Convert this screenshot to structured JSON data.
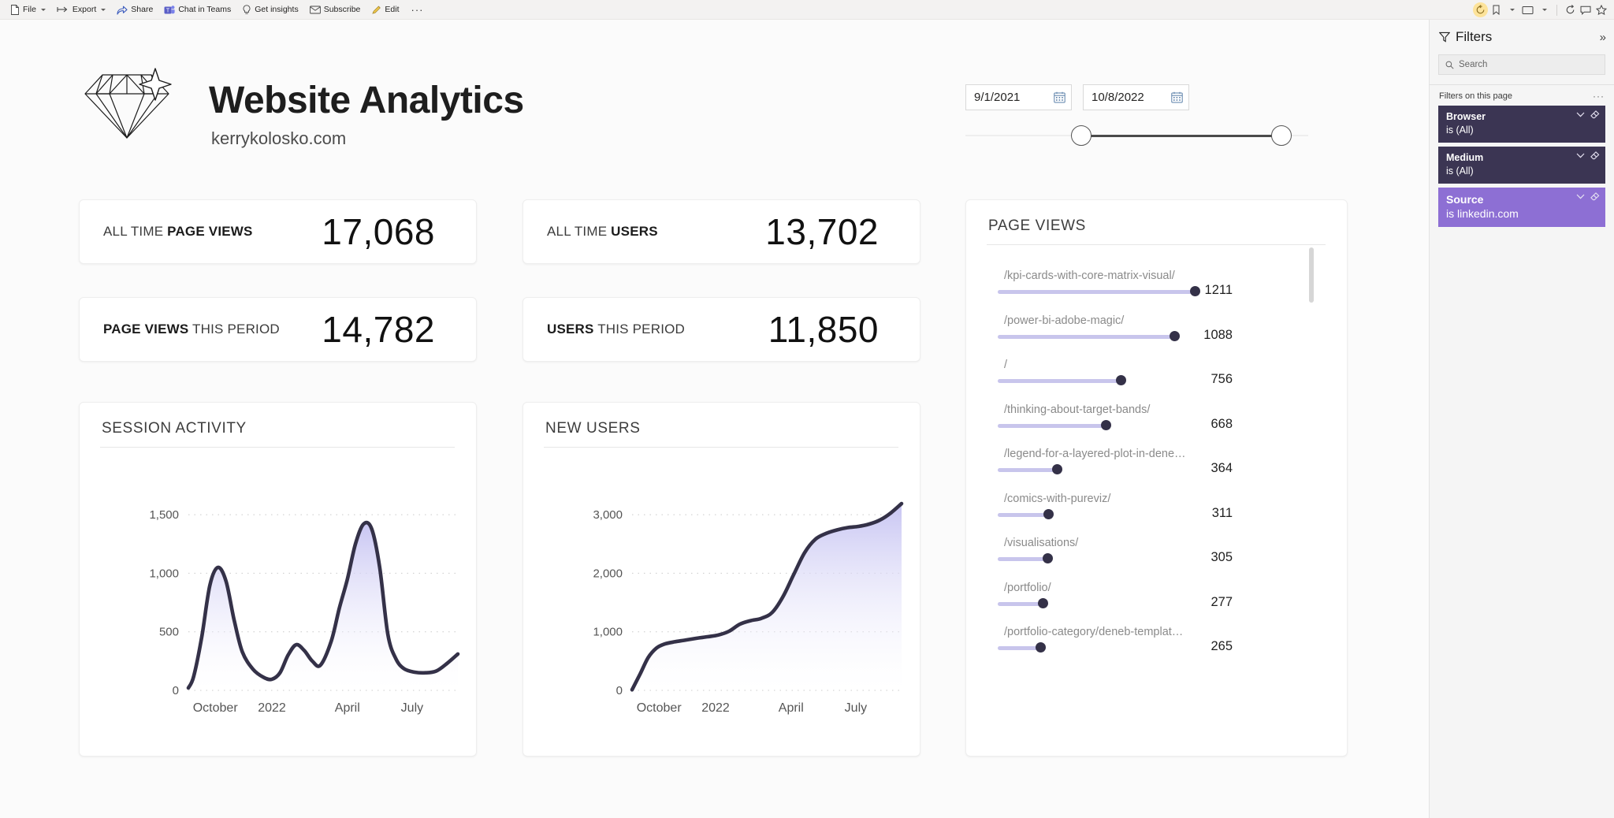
{
  "toolbar": {
    "items": [
      {
        "label": "File",
        "icon": "file-icon",
        "caret": true
      },
      {
        "label": "Export",
        "icon": "export-icon",
        "caret": true
      },
      {
        "label": "Share",
        "icon": "share-icon",
        "caret": false
      },
      {
        "label": "Chat in Teams",
        "icon": "teams-icon",
        "caret": false
      },
      {
        "label": "Get insights",
        "icon": "lightbulb-icon",
        "caret": false
      },
      {
        "label": "Subscribe",
        "icon": "envelope-icon",
        "caret": false
      },
      {
        "label": "Edit",
        "icon": "pencil-icon",
        "caret": false
      }
    ],
    "more_label": "···",
    "right_icons": [
      "reset-icon",
      "bookmarks-icon",
      "chevron-down-icon",
      "view-icon",
      "chevron-down-icon",
      "refresh-icon",
      "comment-icon",
      "favorite-icon"
    ]
  },
  "header": {
    "title": "Website Analytics",
    "subtitle": "kerrykolosko.com",
    "logo": "diamond-logo"
  },
  "slicer": {
    "start_date": "9/1/2021",
    "end_date": "10/8/2022",
    "calendar_icon": "calendar-icon"
  },
  "kpis": [
    {
      "label_light": "ALL TIME ",
      "label_bold": "PAGE VIEWS",
      "value": "17,068"
    },
    {
      "label_light": "ALL TIME ",
      "label_bold": "USERS",
      "value": "13,702"
    },
    {
      "label_bold": "PAGE VIEWS",
      "label_light": " THIS PERIOD",
      "value": "14,782"
    },
    {
      "label_bold": "USERS",
      "label_light": " THIS PERIOD",
      "value": "11,850"
    }
  ],
  "charts": {
    "session_activity_title": "SESSION ACTIVITY",
    "new_users_title": "NEW USERS",
    "page_views_title": "PAGE VIEWS"
  },
  "chart_data": [
    {
      "type": "area",
      "title": "SESSION ACTIVITY",
      "xlabel": "",
      "ylabel": "",
      "ylim": [
        0,
        1750
      ],
      "yticks": [
        "0",
        "500",
        "1,000",
        "1,500"
      ],
      "ytick_values": [
        0,
        500,
        1000,
        1500
      ],
      "xticks": [
        "October",
        "2022",
        "April",
        "July"
      ],
      "xtick_positions": [
        0.1,
        0.31,
        0.59,
        0.83
      ],
      "grid": true,
      "line_color": "#343148",
      "fill_top": "#c5c2f2",
      "fill_bottom": "#ffffff",
      "x": [
        0,
        0.02,
        0.05,
        0.08,
        0.11,
        0.14,
        0.17,
        0.2,
        0.24,
        0.28,
        0.31,
        0.34,
        0.37,
        0.4,
        0.43,
        0.46,
        0.49,
        0.53,
        0.56,
        0.59,
        0.62,
        0.65,
        0.68,
        0.71,
        0.74,
        0.77,
        0.8,
        0.84,
        0.88,
        0.92,
        0.96,
        1.0
      ],
      "values": [
        20,
        120,
        460,
        900,
        1050,
        930,
        600,
        330,
        180,
        110,
        95,
        150,
        300,
        390,
        340,
        250,
        215,
        420,
        700,
        950,
        1250,
        1420,
        1380,
        1050,
        480,
        270,
        185,
        155,
        150,
        165,
        230,
        310
      ]
    },
    {
      "type": "area",
      "title": "NEW USERS",
      "xlabel": "",
      "ylabel": "",
      "ylim": [
        0,
        3500
      ],
      "yticks": [
        "0",
        "1,000",
        "2,000",
        "3,000"
      ],
      "ytick_values": [
        0,
        1000,
        2000,
        3000
      ],
      "xticks": [
        "October",
        "2022",
        "April",
        "July"
      ],
      "xtick_positions": [
        0.1,
        0.31,
        0.59,
        0.83
      ],
      "grid": true,
      "line_color": "#343148",
      "fill_top": "#c5c2f2",
      "fill_bottom": "#ffffff",
      "x": [
        0,
        0.03,
        0.06,
        0.09,
        0.12,
        0.16,
        0.2,
        0.24,
        0.28,
        0.32,
        0.36,
        0.4,
        0.44,
        0.48,
        0.52,
        0.56,
        0.6,
        0.64,
        0.68,
        0.72,
        0.76,
        0.8,
        0.84,
        0.88,
        0.92,
        0.96,
        1.0
      ],
      "values": [
        10,
        280,
        560,
        720,
        790,
        830,
        860,
        890,
        915,
        945,
        1010,
        1130,
        1190,
        1230,
        1330,
        1600,
        1980,
        2350,
        2580,
        2680,
        2740,
        2780,
        2800,
        2840,
        2910,
        3030,
        3190
      ]
    },
    {
      "type": "bar",
      "title": "PAGE VIEWS",
      "xlabel": "",
      "ylabel": "",
      "grid": false,
      "track_color": "#c8c5ec",
      "dot_color": "#343148",
      "max_value": 1211,
      "categories": [
        "/kpi-cards-with-core-matrix-visual/",
        "/power-bi-adobe-magic/",
        "/",
        "/thinking-about-target-bands/",
        "/legend-for-a-layered-plot-in-dene…",
        "/comics-with-pureviz/",
        "/visualisations/",
        "/portfolio/",
        "/portfolio-category/deneb-templat…"
      ],
      "values": [
        1211,
        1088,
        756,
        668,
        364,
        311,
        305,
        277,
        265
      ]
    }
  ],
  "filters": {
    "title": "Filters",
    "filter_icon": "filter-icon",
    "expand_icon": "double-chevron-right-icon",
    "search_placeholder": "Search",
    "search_icon": "search-icon",
    "group_label": "Filters on this page",
    "group_more": "···",
    "cards": [
      {
        "field": "Browser",
        "condition": "is (All)",
        "state": "inactive"
      },
      {
        "field": "Medium",
        "condition": "is (All)",
        "state": "inactive"
      },
      {
        "field": "Source",
        "condition": "is linkedin.com",
        "state": "active"
      }
    ],
    "card_icons": [
      "chevron-down-icon",
      "eraser-icon"
    ]
  },
  "colors": {
    "accent_purple": "#8d6fd4",
    "filter_dark": "#3b3553",
    "line_navy": "#343148",
    "track_lavender": "#c8c5ec",
    "canvas_bg": "#fbfbfb"
  }
}
